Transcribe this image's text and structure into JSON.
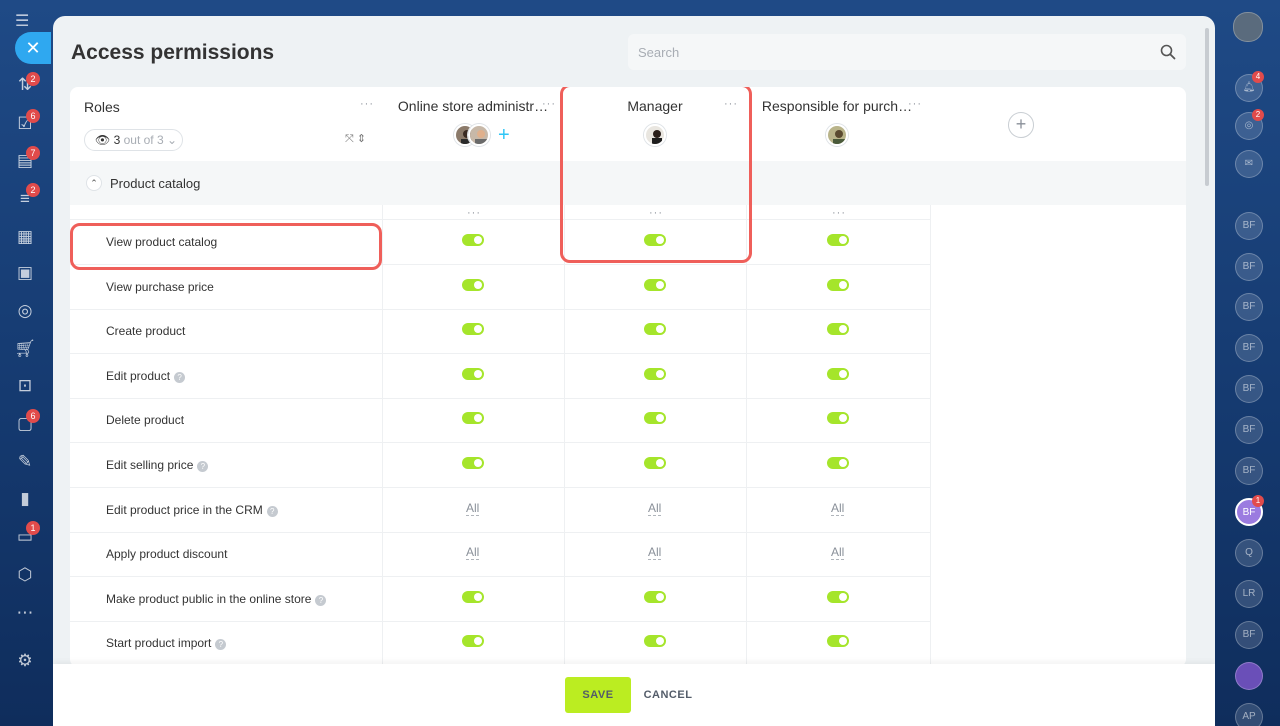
{
  "page": {
    "title": "Access permissions",
    "search_placeholder": "Search"
  },
  "roles_header": {
    "label": "Roles",
    "filter_count": "3",
    "filter_suffix": "out of 3"
  },
  "columns": [
    {
      "title": "Online store administr…"
    },
    {
      "title": "Manager"
    },
    {
      "title": "Responsible for purch…"
    }
  ],
  "section": {
    "title": "Product catalog"
  },
  "permissions": [
    {
      "label": "View product catalog",
      "help": false,
      "values": [
        "on",
        "on",
        "on"
      ]
    },
    {
      "label": "View purchase price",
      "help": false,
      "values": [
        "on",
        "on",
        "on"
      ]
    },
    {
      "label": "Create product",
      "help": false,
      "values": [
        "on",
        "on",
        "on"
      ]
    },
    {
      "label": "Edit product",
      "help": true,
      "values": [
        "on",
        "on",
        "on"
      ]
    },
    {
      "label": "Delete product",
      "help": false,
      "values": [
        "on",
        "on",
        "on"
      ]
    },
    {
      "label": "Edit selling price",
      "help": true,
      "values": [
        "on",
        "on",
        "on"
      ]
    },
    {
      "label": "Edit product price in the CRM",
      "help": true,
      "values": [
        "All",
        "All",
        "All"
      ]
    },
    {
      "label": "Apply product discount",
      "help": false,
      "values": [
        "All",
        "All",
        "All"
      ]
    },
    {
      "label": "Make product public in the online store",
      "help": true,
      "values": [
        "on",
        "on",
        "on"
      ]
    },
    {
      "label": "Start product import",
      "help": true,
      "values": [
        "on",
        "on",
        "on"
      ]
    }
  ],
  "footer": {
    "save_label": "SAVE",
    "cancel_label": "CANCEL"
  },
  "left_rail": {
    "badges": [
      "2",
      "6",
      "7",
      "2",
      "6",
      "1"
    ]
  },
  "right_rail": {
    "notification_count": "4",
    "copilot_count": "2",
    "contacts": [
      "BF",
      "BF",
      "BF",
      "BF",
      "BF",
      "BF",
      "BF",
      "BF",
      "Q",
      "LR",
      "BF",
      "",
      "AP"
    ],
    "active_contact_badge": "1"
  },
  "colors": {
    "accent": "#2fc6f6",
    "toggle_on": "#a5e52b",
    "save_button": "#bbed21",
    "highlight": "#ef5f5a"
  }
}
